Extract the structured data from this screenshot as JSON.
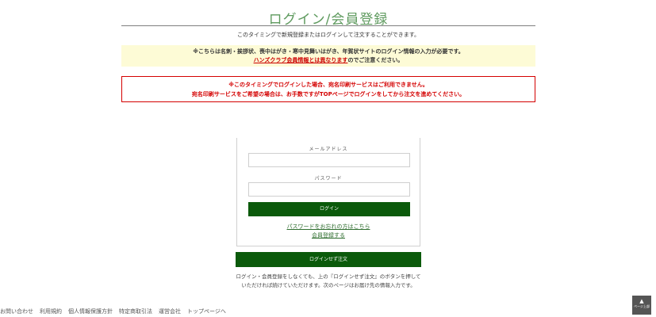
{
  "header": {
    "title": "ログイン/会員登録",
    "intro": "このタイミングで新規登録またはログインして注文することができます。"
  },
  "notice_yellow": {
    "line1": "※こちらは名刺・挨拶状、喪中はがき・寒中見舞いはがき、年賀状サイトのログイン情報の入力が必要です。",
    "link_text": "ハンズクラブ会員情報とは異なります",
    "line2_suffix": "のでご注意ください。"
  },
  "notice_red": {
    "line1": "※このタイミングでログインした場合、宛名印刷サービスはご利用できません。",
    "line2": "宛名印刷サービスをご希望の場合は、お手数ですがTOPページでログインをしてから注文を進めてください。"
  },
  "login_form": {
    "email_label": "メールアドレス",
    "email_value": "",
    "password_label": "パスワード",
    "password_value": "",
    "login_button": "ログイン",
    "forgot_password_link": "パスワードをお忘れの方はこちら",
    "register_link": "会員登録する"
  },
  "guest": {
    "button": "ログインせず注文",
    "note": "ログイン・会員登録をしなくても、上の『ログインせず注文』のボタンを押していただければ続けていただけます。次のページはお届け先の情報入力です。"
  },
  "footer": {
    "links": [
      "お問い合わせ",
      "利用規約",
      "個人情報保護方針",
      "特定商取引法",
      "運営会社",
      "トップページへ"
    ]
  },
  "pagetop": {
    "label": "ページ上部"
  }
}
